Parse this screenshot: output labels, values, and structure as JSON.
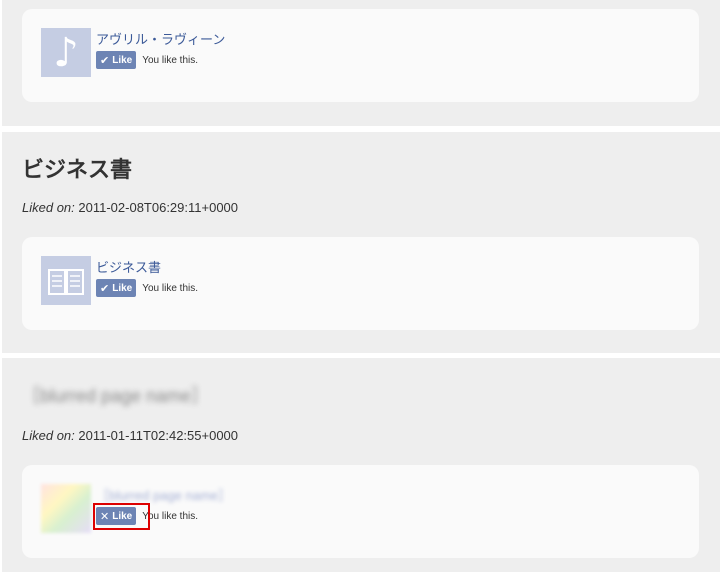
{
  "items": [
    {
      "heading": "",
      "liked_label": "",
      "liked_value": "",
      "card": {
        "thumb_icon": "music-note-icon",
        "thumb_glyph": "♪",
        "title": "アヴリル・ラヴィーン",
        "like_icon": "checkmark-icon",
        "like_glyph": "✔",
        "like_label": "Like",
        "status": "You like this."
      }
    },
    {
      "heading": "ビジネス書",
      "liked_label": "Liked on:",
      "liked_value": "2011-02-08T06:29:11+0000",
      "card": {
        "thumb_icon": "book-icon",
        "title": "ビジネス書",
        "like_icon": "checkmark-icon",
        "like_glyph": "✔",
        "like_label": "Like",
        "status": "You like this."
      }
    },
    {
      "heading": "［blurred page name］",
      "liked_label": "Liked on:",
      "liked_value": "2011-01-11T02:42:55+0000",
      "card": {
        "thumb_icon": "blurred-thumbnail",
        "title": "［blurred page name］",
        "like_icon": "close-icon",
        "like_glyph": "✕",
        "like_label": "Like",
        "status": "You like this."
      }
    }
  ],
  "colors": {
    "like_button": "#6d84b4",
    "highlight": "#dd0000",
    "title_link": "#3b5998",
    "thumb": "#c5cde3"
  }
}
